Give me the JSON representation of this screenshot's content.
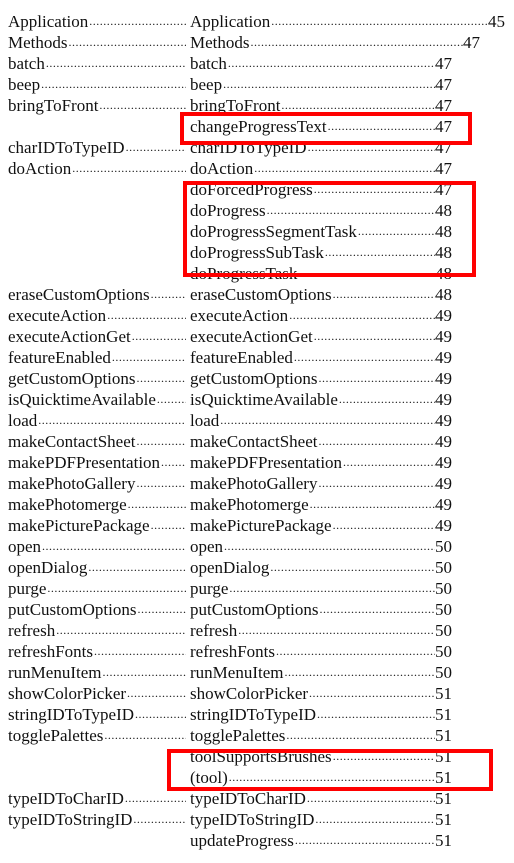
{
  "highlight_color": "#ff0000",
  "rows": [
    {
      "left": "Application",
      "right": "Application",
      "page": "45"
    },
    {
      "left": "Methods",
      "right": "Methods",
      "page": "47"
    },
    {
      "left": "batch",
      "right": "batch",
      "page": "47"
    },
    {
      "left": "beep",
      "right": "beep",
      "page": "47"
    },
    {
      "left": "bringToFront",
      "right": "bringToFront",
      "page": "47"
    },
    {
      "left": "",
      "right": "changeProgressText",
      "page": "47"
    },
    {
      "left": "charIDToTypeID",
      "right": "charIDToTypeID",
      "page": "47"
    },
    {
      "left": "doAction",
      "right": "doAction",
      "page": "47"
    },
    {
      "left": "",
      "right": "doForcedProgress",
      "page": "47"
    },
    {
      "left": "",
      "right": "doProgress",
      "page": "48"
    },
    {
      "left": "",
      "right": "doProgressSegmentTask",
      "page": "48"
    },
    {
      "left": "",
      "right": "doProgressSubTask",
      "page": "48"
    },
    {
      "left": "",
      "right": "doProgressTask",
      "page": "48"
    },
    {
      "left": "eraseCustomOptions",
      "right": "eraseCustomOptions",
      "page": "48"
    },
    {
      "left": "executeAction",
      "right": "executeAction",
      "page": "49"
    },
    {
      "left": "executeActionGet",
      "right": "executeActionGet",
      "page": "49"
    },
    {
      "left": "featureEnabled",
      "right": "featureEnabled",
      "page": "49"
    },
    {
      "left": "getCustomOptions",
      "right": "getCustomOptions",
      "page": "49"
    },
    {
      "left": "isQuicktimeAvailable",
      "right": "isQuicktimeAvailable",
      "page": "49"
    },
    {
      "left": "load",
      "right": "load",
      "page": "49"
    },
    {
      "left": "makeContactSheet",
      "right": "makeContactSheet",
      "page": "49"
    },
    {
      "left": "makePDFPresentation",
      "right": "makePDFPresentation",
      "page": "49"
    },
    {
      "left": "makePhotoGallery",
      "right": "makePhotoGallery",
      "page": "49"
    },
    {
      "left": "makePhotomerge",
      "right": "makePhotomerge",
      "page": "49"
    },
    {
      "left": "makePicturePackage",
      "right": "makePicturePackage",
      "page": "49"
    },
    {
      "left": "open",
      "right": "open",
      "page": "50"
    },
    {
      "left": "openDialog",
      "right": "openDialog",
      "page": "50"
    },
    {
      "left": "purge",
      "right": "purge",
      "page": "50"
    },
    {
      "left": "putCustomOptions",
      "right": "putCustomOptions",
      "page": "50"
    },
    {
      "left": "refresh",
      "right": "refresh",
      "page": "50"
    },
    {
      "left": "refreshFonts",
      "right": "refreshFonts",
      "page": "50"
    },
    {
      "left": "runMenuItem",
      "right": "runMenuItem",
      "page": "50"
    },
    {
      "left": "showColorPicker",
      "right": "showColorPicker",
      "page": "51"
    },
    {
      "left": "stringIDToTypeID",
      "right": "stringIDToTypeID",
      "page": "51"
    },
    {
      "left": "togglePalettes",
      "right": "togglePalettes",
      "page": "51"
    },
    {
      "left": "",
      "right": "toolSupportsBrushes",
      "page": "51"
    },
    {
      "left": "",
      "right": "(tool)",
      "page": "51"
    },
    {
      "left": "typeIDToCharID",
      "right": "typeIDToCharID",
      "page": "51"
    },
    {
      "left": "typeIDToStringID",
      "right": "typeIDToStringID",
      "page": "51"
    },
    {
      "left": "",
      "right": "updateProgress",
      "page": "51"
    }
  ]
}
